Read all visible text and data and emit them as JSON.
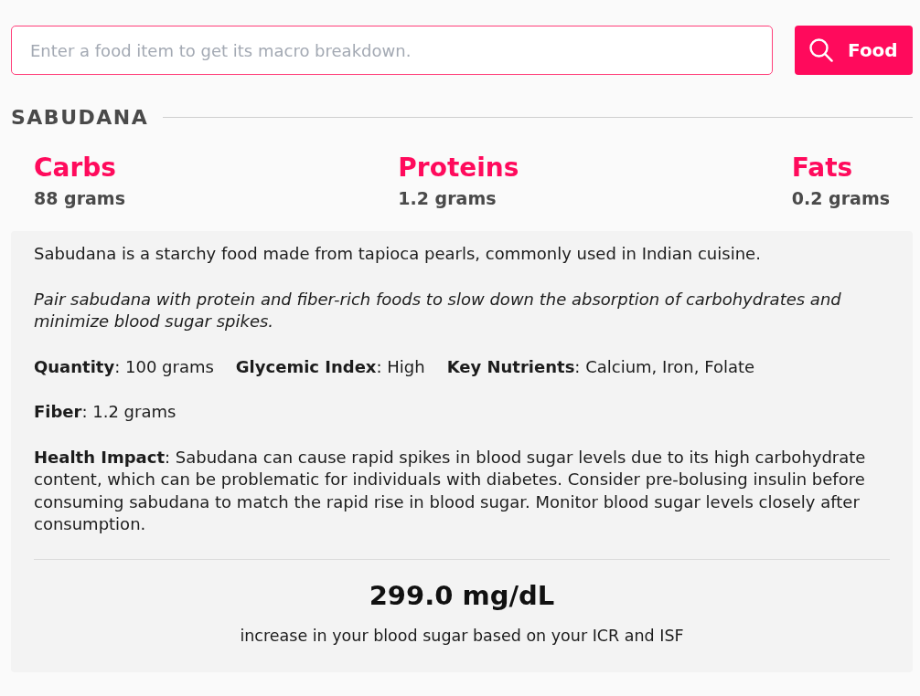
{
  "search": {
    "placeholder": "Enter a food item to get its macro breakdown.",
    "button_label": "Food"
  },
  "food": {
    "name": "SABUDANA",
    "macros": [
      {
        "name": "Carbs",
        "amount": "88 grams"
      },
      {
        "name": "Proteins",
        "amount": "1.2 grams"
      },
      {
        "name": "Fats",
        "amount": "0.2 grams"
      }
    ],
    "description": "Sabudana is a starchy food made from tapioca pearls, commonly used in Indian cuisine.",
    "tip": "Pair sabudana with protein and fiber-rich foods to slow down the absorption of carbohydrates and minimize blood sugar spikes.",
    "fact_rows": [
      [
        "**Quantity**: 100 grams",
        "**Glycemic Index**: High",
        "**Key Nutrients**: Calcium, Iron, Folate"
      ],
      [
        "**Fiber**: 1.2 grams"
      ]
    ],
    "health_impact": "**Health Impact**: Sabudana can cause rapid spikes in blood sugar levels due to its high carbohydrate content, which can be problematic for individuals with diabetes. Consider pre-bolusing insulin before consuming sabudana to match the rapid rise in blood sugar. Monitor blood sugar levels closely after consumption.",
    "result": {
      "value": "299.0 mg/dL",
      "caption": "increase in your blood sugar based on your ICR and ISF"
    }
  }
}
